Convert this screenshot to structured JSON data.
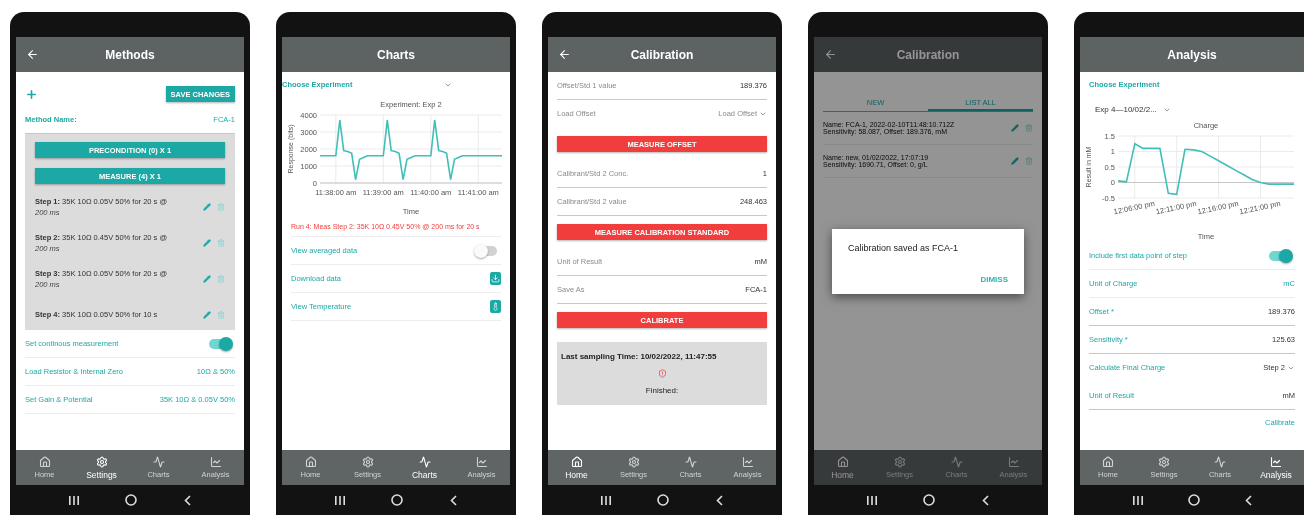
{
  "screens": [
    {
      "title": "Methods",
      "back": true,
      "items": [
        {
          "kind": "toolbar",
          "button": "SAVE CHANGES"
        },
        {
          "kind": "name_field",
          "label": "Method Name:",
          "value": "FCA-1"
        },
        {
          "kind": "section",
          "buttons": [
            "PRECONDITION (0) X 1",
            "MEASURE (4) X 1"
          ],
          "steps": [
            {
              "label": "Step 1:",
              "text": "35K 10Ω 0.05V 50% for 20 s @",
              "note": "200 ms"
            },
            {
              "label": "Step 2:",
              "text": "35K 10Ω 0.45V 50% for 20 s @",
              "note": "200 ms"
            },
            {
              "label": "Step 3:",
              "text": "35K 10Ω 0.05V 50% for 20 s @",
              "note": "200 ms"
            },
            {
              "label": "Step 4:",
              "text": "35K 10Ω 0.05V 50% for 10 s"
            }
          ]
        },
        {
          "kind": "toggle",
          "label": "Set continous measurement",
          "on": true
        },
        {
          "kind": "value",
          "label": "Load Resistor & Internal Zero",
          "value": "10Ω & 50%"
        },
        {
          "kind": "value",
          "label": "Set Gain & Potential",
          "value": "35K 10Ω & 0.05V 50%"
        }
      ],
      "nav": [
        {
          "label": "Home",
          "selected": false
        },
        {
          "label": "Settings",
          "selected": true
        },
        {
          "label": "Charts",
          "selected": false
        },
        {
          "label": "Analysis",
          "selected": false
        }
      ]
    },
    {
      "title": "Charts",
      "back": false,
      "items": [
        {
          "kind": "dropdown",
          "label": "Choose Experiment"
        },
        {
          "kind": "chart",
          "chart_data": {
            "type": "line",
            "title": "Experiment: Exp 2",
            "xlabel": "Time",
            "ylabel": "Response (bits)",
            "categories": [
              null,
              null,
              null,
              null,
              "11:38:00 am",
              null,
              null,
              null,
              null,
              null,
              null,
              null,
              null,
              null,
              null,
              null,
              "11:39:00 am",
              null,
              null,
              null,
              null,
              null,
              null,
              null,
              null,
              null,
              null,
              null,
              "11:40:00 am",
              null,
              null,
              null,
              null,
              null,
              null,
              null,
              null,
              null,
              null,
              null,
              "11:41:00 am",
              null,
              null,
              null,
              null,
              null,
              null
            ],
            "series": [
              {
                "color": "#3fbfb8",
                "values": [
                  1600,
                  1600,
                  1600,
                  1600,
                  1600,
                  3700,
                  1900,
                  1850,
                  1750,
                  200,
                  1400,
                  1500,
                  1600,
                  1600,
                  1600,
                  1600,
                  1600,
                  3700,
                  1900,
                  1850,
                  1750,
                  200,
                  1400,
                  1500,
                  1600,
                  1600,
                  1600,
                  1600,
                  1600,
                  3700,
                  1900,
                  1850,
                  1750,
                  200,
                  1400,
                  1500,
                  1600,
                  1600,
                  1600,
                  1600,
                  1600,
                  1600,
                  1600,
                  1600,
                  1600,
                  1600,
                  1600
                ]
              }
            ],
            "ylim": [
              0,
              4000
            ],
            "yticks": [
              0,
              1000,
              2000,
              3000,
              4000
            ],
            "grid": true
          }
        },
        {
          "kind": "alert",
          "text": "Run 4: Meas Step 2: 35K 10Ω 0.45V 50% @ 200 ms for 20 s"
        },
        {
          "kind": "toggle",
          "label": "View averaged data",
          "on": false
        },
        {
          "kind": "download",
          "label": "Download data"
        },
        {
          "kind": "temperature",
          "label": "View Temperature"
        }
      ],
      "nav": [
        {
          "label": "Home",
          "selected": false
        },
        {
          "label": "Settings",
          "selected": false
        },
        {
          "label": "Charts",
          "selected": true
        },
        {
          "label": "Analysis",
          "selected": false
        }
      ]
    },
    {
      "title": "Calibration",
      "back": true,
      "items": [
        {
          "kind": "field",
          "label": "Offset/Std 1 value",
          "value": "189.376"
        },
        {
          "kind": "select",
          "label": "Load Offset",
          "placeholder": "Load Offset"
        },
        {
          "kind": "button",
          "text": "MEASURE OFFSET"
        },
        {
          "kind": "field",
          "label": "Calibrant/Std 2 Conc.",
          "value": "1"
        },
        {
          "kind": "field",
          "label": "Calibrant/Std 2 value",
          "value": "248.463"
        },
        {
          "kind": "button",
          "text": "MEASURE CALIBRATION STANDARD"
        },
        {
          "kind": "field",
          "label": "Unit of Result",
          "value": "mM"
        },
        {
          "kind": "field",
          "label": "Save As",
          "value": "FCA-1"
        },
        {
          "kind": "button",
          "text": "CALIBRATE"
        },
        {
          "kind": "status",
          "time": "Last sampling Time: 10/02/2022, 11:47:55",
          "state": "Finished:"
        }
      ],
      "nav": [
        {
          "label": "Home",
          "selected": true
        },
        {
          "label": "Settings",
          "selected": false
        },
        {
          "label": "Charts",
          "selected": false
        },
        {
          "label": "Analysis",
          "selected": false
        }
      ]
    },
    {
      "title": "Calibration",
      "back": true,
      "items": [
        {
          "kind": "tabs",
          "tabs": [
            {
              "label": "NEW",
              "selected": false
            },
            {
              "label": "LIST ALL",
              "selected": true
            }
          ]
        },
        {
          "kind": "entry",
          "name": "Name: FCA-1, 2022-02-10T11:48:10.712Z",
          "detail": "Sensitivity: 58.087, Offset: 189.376, mM"
        },
        {
          "kind": "entry",
          "name": "Name: new, 01/02/2022, 17:07:19",
          "detail": "Sensitivity: 1690.71, Offset: 0, g/L"
        }
      ],
      "dialog": {
        "message": "Calibration saved as FCA-1",
        "action": "DIMISS"
      },
      "nav": [
        {
          "label": "Home",
          "selected": true
        },
        {
          "label": "Settings",
          "selected": false
        },
        {
          "label": "Charts",
          "selected": false
        },
        {
          "label": "Analysis",
          "selected": false
        }
      ]
    },
    {
      "title": "Analysis",
      "back": false,
      "items": [
        {
          "kind": "heading",
          "text": "Choose Experiment"
        },
        {
          "kind": "picker",
          "value": "Exp 4—10/02/2..."
        },
        {
          "kind": "chart",
          "chart_data": {
            "type": "line",
            "title": "Charge",
            "xlabel": "Time",
            "ylabel": "Result in mM",
            "categories": [
              null,
              null,
              "12:06:00 pm",
              null,
              null,
              null,
              null,
              "12:11:00 pm",
              null,
              null,
              null,
              null,
              "12:16:00 pm",
              null,
              null,
              null,
              null,
              "12:21:00 pm",
              null,
              null,
              null,
              null
            ],
            "series": [
              {
                "color": "#3fbfb8",
                "values": [
                  0.05,
                  0.02,
                  1.25,
                  1.1,
                  1.1,
                  1.1,
                  -0.35,
                  -0.38,
                  1.07,
                  1.05,
                  1.0,
                  0.85,
                  0.7,
                  0.55,
                  0.4,
                  0.25,
                  0.1,
                  0,
                  -0.05,
                  -0.05,
                  -0.05,
                  -0.05
                ]
              }
            ],
            "ylim": [
              -0.5,
              1.5
            ],
            "yticks": [
              -0.5,
              0,
              0.5,
              1,
              1.5
            ],
            "grid": true
          }
        },
        {
          "kind": "toggle",
          "label": "Include first data point of step",
          "on": true
        },
        {
          "kind": "value",
          "label": "Unit of Charge",
          "value": "mC"
        },
        {
          "kind": "teal_field",
          "label": "Offset *",
          "value": "189.376"
        },
        {
          "kind": "teal_field",
          "label": "Sensitivity *",
          "value": "125.63"
        },
        {
          "kind": "teal_select",
          "label": "Calculate Final Charge",
          "value": "Step 2"
        },
        {
          "kind": "teal_field",
          "label": "Unit of Result",
          "value": "mM"
        },
        {
          "kind": "link",
          "text": "Calibrate"
        }
      ],
      "nav": [
        {
          "label": "Home",
          "selected": false
        },
        {
          "label": "Settings",
          "selected": false
        },
        {
          "label": "Charts",
          "selected": false
        },
        {
          "label": "Analysis",
          "selected": true
        }
      ]
    }
  ]
}
